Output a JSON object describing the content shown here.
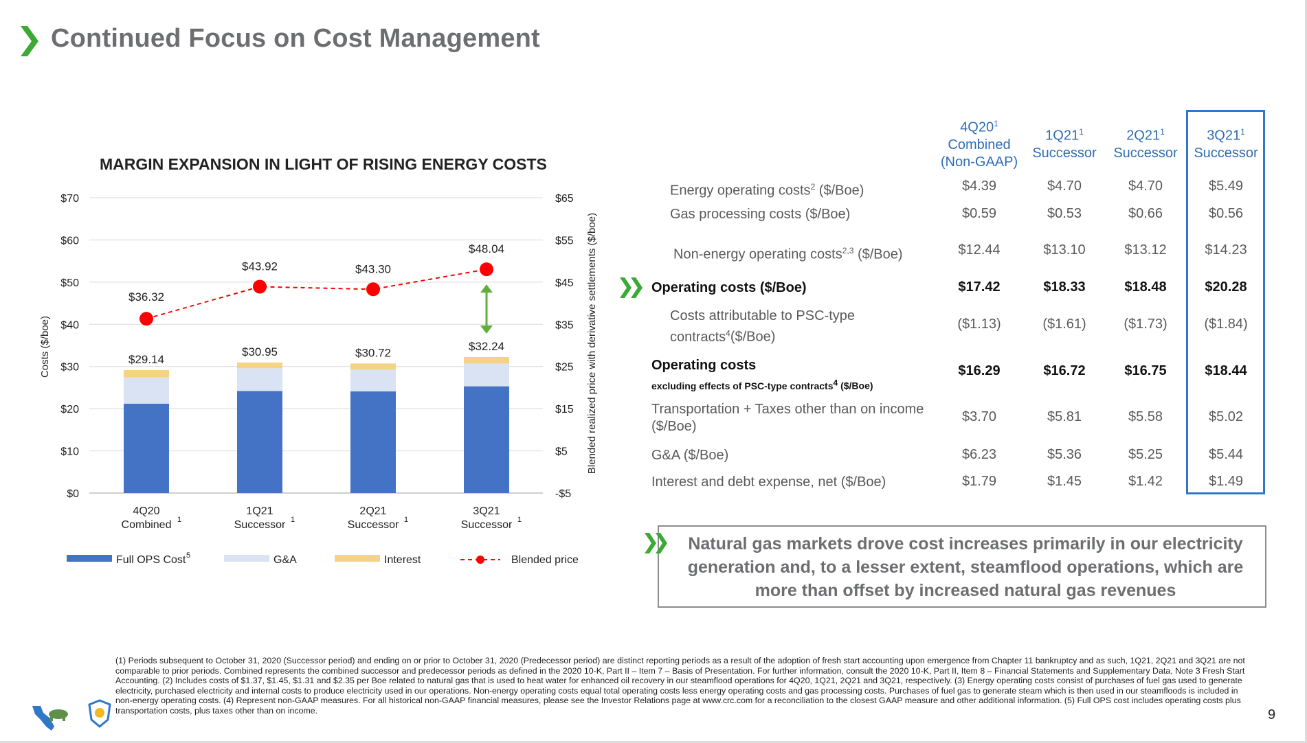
{
  "slide": {
    "title": "Continued Focus on Cost Management",
    "page_number": "9",
    "callout": "Natural gas markets drove cost increases primarily in our electricity generation and, to a lesser extent, steamflood operations, which are more than offset by increased natural gas revenues",
    "footnote": "(1) Periods subsequent to October 31, 2020 (Successor period) and ending on or prior to October 31, 2020 (Predecessor period) are distinct reporting periods as a result of the adoption of fresh start accounting upon emergence from Chapter 11 bankruptcy and as such, 1Q21, 2Q21 and 3Q21 are not comparable to prior periods. Combined represents the combined successor and predecessor periods as defined in the 2020 10-K, Part II – Item 7 – Basis of Presentation. For further information, consult the 2020 10-K, Part II, Item 8 – Financial Statements and Supplementary Data, Note 3 Fresh Start Accounting. (2) Includes costs of $1.37, $1.45, $1.31 and $2.35 per Boe related to natural gas that is used to heat water for enhanced oil recovery in our steamflood operations for 4Q20, 1Q21, 2Q21 and 3Q21, respectively. (3) Energy operating costs consist of purchases of fuel gas used to generate electricity, purchased electricity and internal costs to produce electricity used in our operations. Non-energy operating costs equal total operating costs less energy operating costs and gas processing costs. Purchases of fuel gas to generate steam which is then used in our steamfloods is included in non-energy operating costs. (4) Represent non-GAAP measures. For all historical non-GAAP financial measures, please see the Investor Relations page at www.crc.com for a reconciliation to the closest GAAP measure and other additional information. (5) Full OPS cost includes operating costs plus transportation costs, plus taxes other than on income."
  },
  "chart_data": {
    "type": "bar",
    "title": "MARGIN EXPANSION IN LIGHT OF RISING ENERGY COSTS",
    "ylabel": "Costs ($/boe)",
    "y2label": "Blended realized price with derivative settlements ($/boe)",
    "ylim": [
      0,
      70
    ],
    "y2lim": [
      -5,
      65
    ],
    "yticks": [
      "$0",
      "$10",
      "$20",
      "$30",
      "$40",
      "$50",
      "$60",
      "$70"
    ],
    "y2ticks": [
      "-$5",
      "$5",
      "$15",
      "$25",
      "$35",
      "$45",
      "$55",
      "$65"
    ],
    "categories": [
      {
        "line1": "4Q20",
        "line2": "Combined",
        "sup": "1"
      },
      {
        "line1": "1Q21",
        "line2": "Successor",
        "sup": "1"
      },
      {
        "line1": "2Q21",
        "line2": "Successor",
        "sup": "1"
      },
      {
        "line1": "3Q21",
        "line2": "Successor",
        "sup": "1"
      }
    ],
    "series": [
      {
        "name": "Full OPS Cost",
        "name_sup": "5",
        "color": "#4472c4",
        "values": [
          21.2,
          24.2,
          24.1,
          25.3
        ]
      },
      {
        "name": "G&A",
        "color": "#dae3f3",
        "values": [
          6.2,
          5.4,
          5.2,
          5.4
        ]
      },
      {
        "name": "Interest",
        "color": "#f4d484",
        "values": [
          1.74,
          1.35,
          1.42,
          1.54
        ]
      }
    ],
    "stack_totals": [
      "$29.14",
      "$30.95",
      "$30.72",
      "$32.24"
    ],
    "line_series": {
      "name": "Blended price",
      "color": "#ff0000",
      "values": [
        36.32,
        43.92,
        43.3,
        48.04
      ],
      "labels": [
        "$36.32",
        "$43.92",
        "$43.30",
        "$48.04"
      ]
    },
    "legend": "bottom",
    "grid": true
  },
  "table": {
    "headers": [
      {
        "lines": [
          "4Q20",
          "Combined",
          "(Non-GAAP)"
        ],
        "sup": "1"
      },
      {
        "lines": [
          "1Q21",
          "Successor"
        ],
        "sup": "1"
      },
      {
        "lines": [
          "2Q21",
          "Successor"
        ],
        "sup": "1"
      },
      {
        "lines": [
          "3Q21",
          "Successor"
        ],
        "sup": "1"
      }
    ],
    "rows": [
      {
        "label": "Energy operating costs",
        "label_sup": "2",
        "label_tail": " ($/Boe)",
        "values": [
          "$4.39",
          "$4.70",
          "$4.70",
          "$5.49"
        ]
      },
      {
        "label": "Gas processing costs ($/Boe)",
        "values": [
          "$0.59",
          "$0.53",
          "$0.66",
          "$0.56"
        ]
      },
      {
        "label": "Non-energy operating costs",
        "label_sup": "2,3",
        "label_tail": " ($/Boe)",
        "values": [
          "$12.44",
          "$13.10",
          "$13.12",
          "$14.23"
        ]
      },
      {
        "label": "Operating costs ($/Boe)",
        "values": [
          "$17.42",
          "$18.33",
          "$18.48",
          "$20.28"
        ]
      },
      {
        "label": "Costs attributable to PSC-type",
        "label2": "contracts",
        "label_sup": "4",
        "label_tail": "($/Boe)",
        "values": [
          "($1.13)",
          "($1.61)",
          "($1.73)",
          "($1.84)"
        ]
      },
      {
        "label": "Operating costs",
        "label2": "excluding effects of PSC-type contracts",
        "label_sup": "4",
        "label_tail": " ($/Boe)",
        "values": [
          "$16.29",
          "$16.72",
          "$16.75",
          "$18.44"
        ]
      },
      {
        "label": "Transportation + Taxes other than on income",
        "label2": "($/Boe)",
        "values": [
          "$3.70",
          "$5.81",
          "$5.58",
          "$5.02"
        ]
      },
      {
        "label": "G&A ($/Boe)",
        "values": [
          "$6.23",
          "$5.36",
          "$5.25",
          "$5.44"
        ]
      },
      {
        "label": "Interest and debt expense, net ($/Boe)",
        "values": [
          "$1.79",
          "$1.45",
          "$1.42",
          "$1.49"
        ]
      }
    ]
  }
}
